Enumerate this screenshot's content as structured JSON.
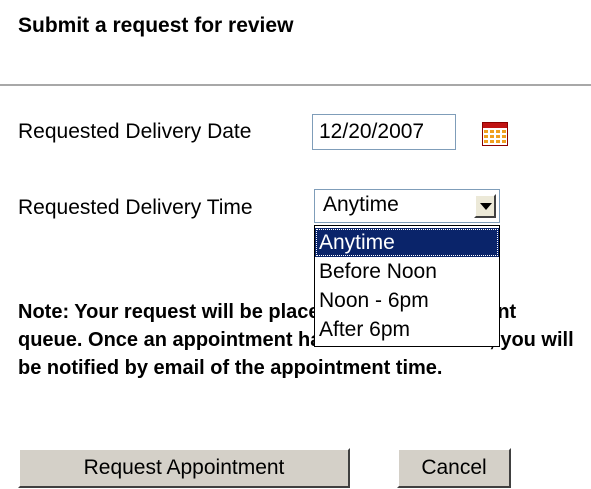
{
  "panel": {
    "title": "Submit a request for review"
  },
  "delivery_date": {
    "label": "Requested Delivery Date",
    "value": "12/20/2007",
    "icon": "calendar-icon"
  },
  "delivery_time": {
    "label": "Requested Delivery Time",
    "selected": "Anytime",
    "options": [
      "Anytime",
      "Before Noon",
      "Noon - 6pm",
      "After 6pm"
    ],
    "highlight_color": "#0a246a"
  },
  "note": {
    "text": "Note: Your request will be placed in the appointment queue. Once an appointment has been scheduled, you will be notified by email of the appointment time."
  },
  "actions": {
    "request_label": "Request Appointment",
    "cancel_label": "Cancel"
  }
}
